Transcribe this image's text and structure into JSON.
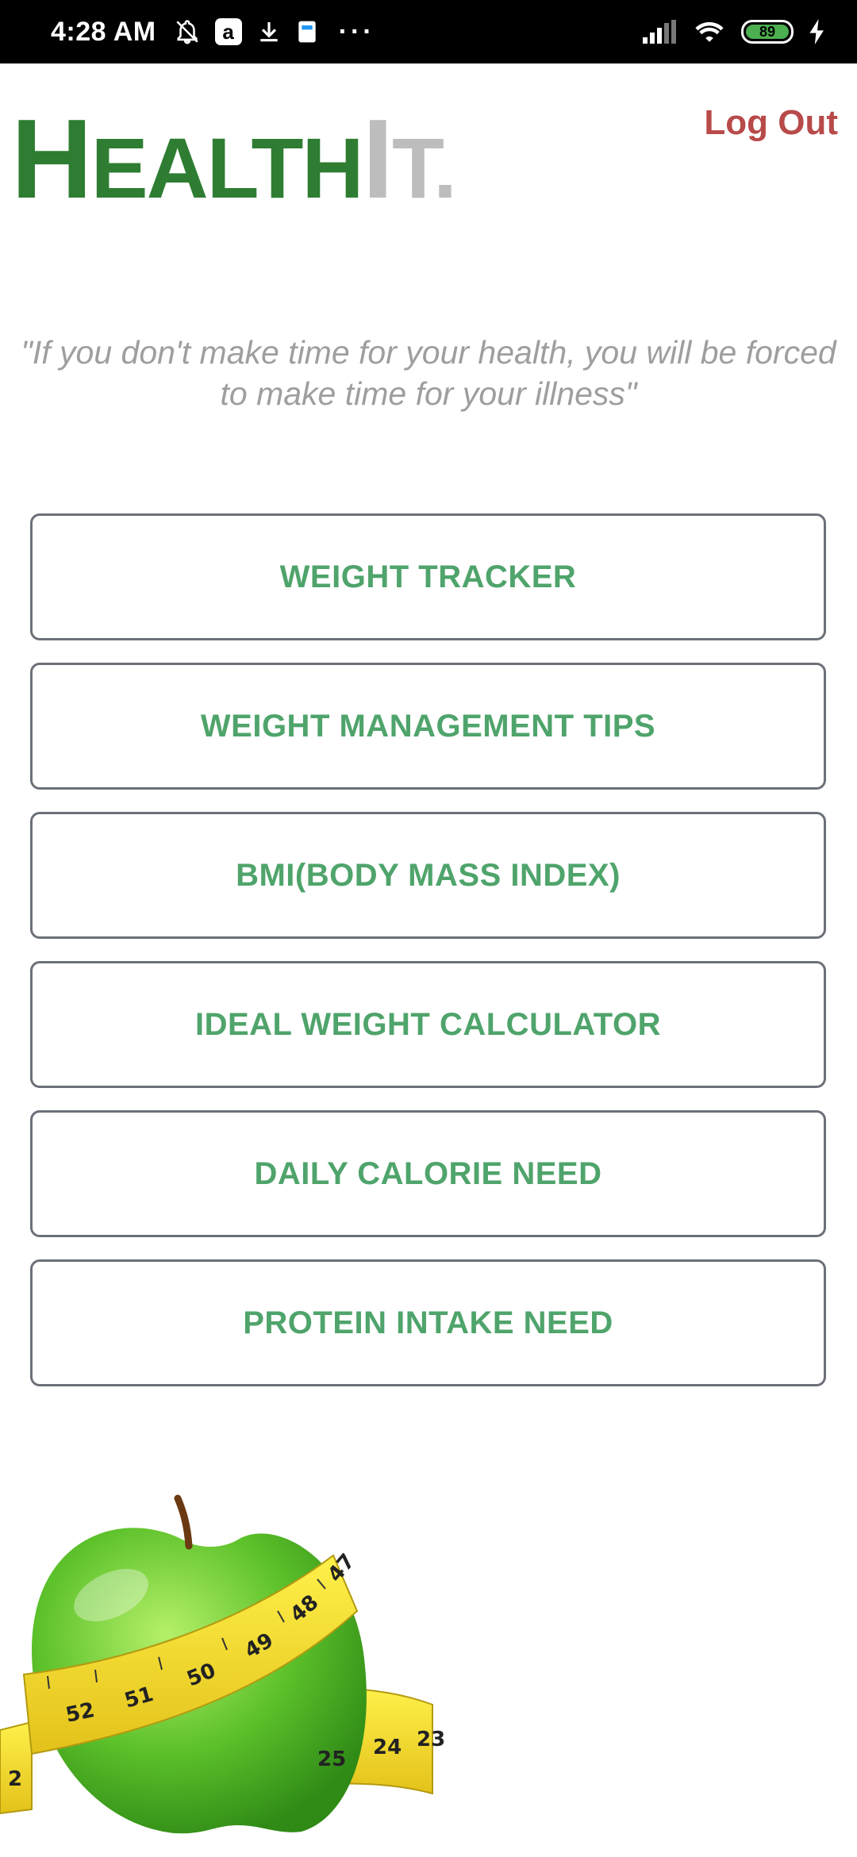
{
  "status_bar": {
    "time": "4:28 AM",
    "amazon_label": "a",
    "battery_level": "89",
    "more_dots": "···"
  },
  "header": {
    "logo": {
      "part1_cap": "H",
      "part1_rest": "EALTH",
      "part2_cap": "I",
      "part2_rest": "T."
    },
    "logout_label": "Log Out"
  },
  "quote": {
    "line1": "\"If you don't make time for your health, you will be forced",
    "line2": "to make time for your illness\""
  },
  "menu": {
    "items": [
      {
        "label": "WEIGHT TRACKER"
      },
      {
        "label": "WEIGHT MANAGEMENT TIPS"
      },
      {
        "label": "BMI(BODY MASS INDEX)"
      },
      {
        "label": "IDEAL WEIGHT CALCULATOR"
      },
      {
        "label": "DAILY CALORIE NEED"
      },
      {
        "label": "PROTEIN INTAKE NEED"
      }
    ]
  },
  "illustration": {
    "icon": "apple-measuring-tape-image",
    "tape_numbers": [
      "52",
      "51",
      "50",
      "49",
      "48",
      "47",
      "2",
      "25",
      "24",
      "23"
    ]
  },
  "colors": {
    "logo_green": "#2e7d32",
    "logo_grey": "#bdbdbd",
    "logout_red": "#b84a4a",
    "button_text_green": "#4fa46b",
    "button_border": "#6b7078",
    "quote_grey": "#9e9e9e"
  }
}
